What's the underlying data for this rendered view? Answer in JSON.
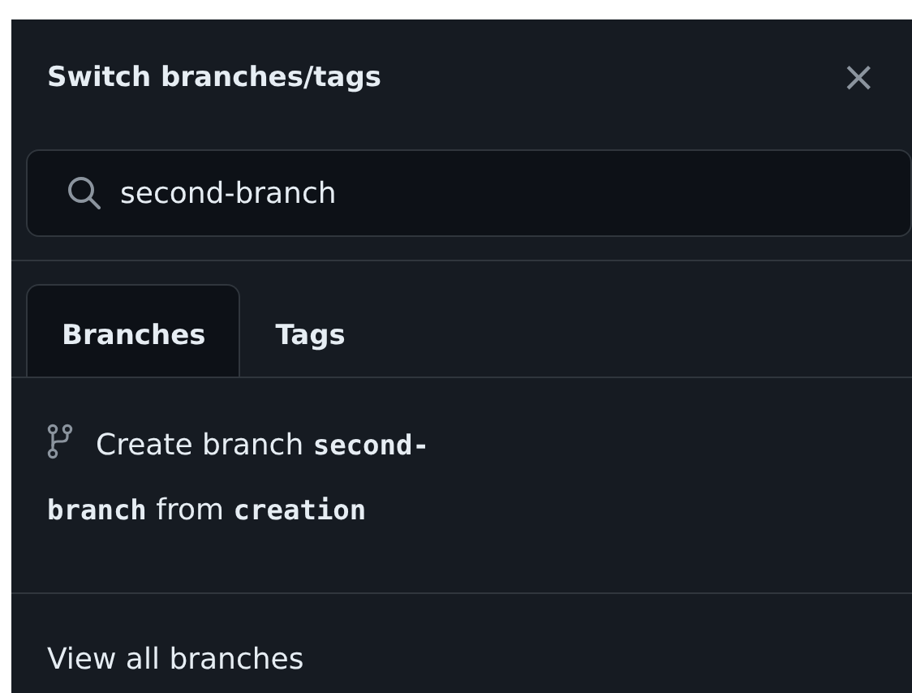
{
  "dialog": {
    "title": "Switch branches/tags",
    "close": "×"
  },
  "search": {
    "value": "second-branch"
  },
  "tabs": [
    {
      "label": "Branches",
      "selected": true
    },
    {
      "label": "Tags",
      "selected": false
    }
  ],
  "create_option": {
    "text": "Create branch **second-branch** from **creation**"
  },
  "footer_link": "View all branches"
}
